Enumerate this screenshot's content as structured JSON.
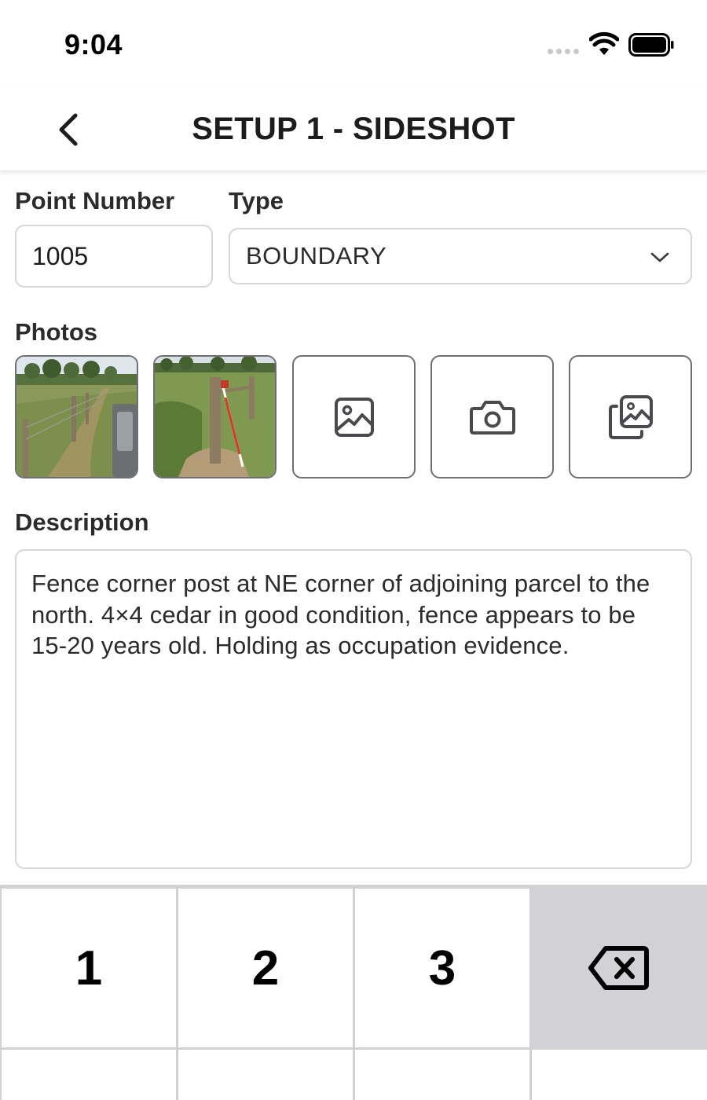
{
  "status_bar": {
    "time": "9:04",
    "icons": [
      "signal-dots-icon",
      "wifi-icon",
      "battery-icon"
    ]
  },
  "header": {
    "title": "SETUP 1 - SIDESHOT",
    "back_icon": "chevron-left-icon"
  },
  "form": {
    "point_number": {
      "label": "Point Number",
      "value": "1005"
    },
    "type": {
      "label": "Type",
      "value": "BOUNDARY",
      "icon": "chevron-down-icon"
    },
    "photos": {
      "label": "Photos",
      "items": [
        {
          "name": "photo-fence-line",
          "kind": "thumbnail"
        },
        {
          "name": "photo-fence-post-rod",
          "kind": "thumbnail"
        }
      ],
      "actions": [
        {
          "name": "add-image-button",
          "icon": "image-icon"
        },
        {
          "name": "take-photo-button",
          "icon": "camera-icon"
        },
        {
          "name": "gallery-button",
          "icon": "gallery-icon"
        }
      ]
    },
    "description": {
      "label": "Description",
      "value": "Fence corner post at NE corner of adjoining parcel to the north. 4×4 cedar in good condition, fence appears to be 15-20 years old. Holding as occupation evidence."
    }
  },
  "keypad": {
    "keys": [
      "1",
      "2",
      "3"
    ],
    "delete_icon": "backspace-icon"
  },
  "colors": {
    "text": "#2b2b2d",
    "border": "#d6d6da",
    "tile_border": "#6e6e73",
    "keypad_bg": "#d1d1d6"
  }
}
